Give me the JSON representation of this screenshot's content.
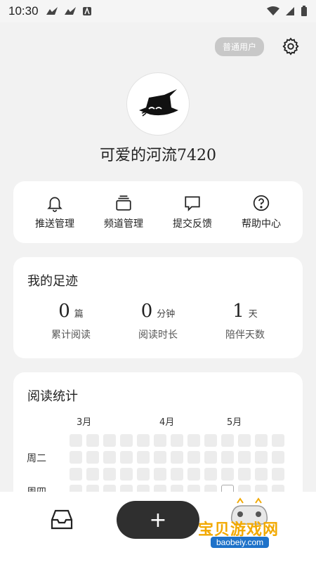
{
  "status_bar": {
    "time": "10:30"
  },
  "header": {
    "user_badge": "普通用户"
  },
  "profile": {
    "username": "可爱的河流7420"
  },
  "actions": [
    {
      "label": "推送管理",
      "icon": "bell-icon"
    },
    {
      "label": "频道管理",
      "icon": "layers-icon"
    },
    {
      "label": "提交反馈",
      "icon": "chat-bubble-icon"
    },
    {
      "label": "帮助中心",
      "icon": "question-circle-icon"
    }
  ],
  "footprint": {
    "title": "我的足迹",
    "stats": [
      {
        "value": "0",
        "unit": "篇",
        "label": "累计阅读"
      },
      {
        "value": "0",
        "unit": "分钟",
        "label": "阅读时长"
      },
      {
        "value": "1",
        "unit": "天",
        "label": "陪伴天数"
      }
    ]
  },
  "reading_stats": {
    "title": "阅读统计",
    "months": [
      "3月",
      "4月",
      "5月"
    ],
    "weekdays": [
      "周二",
      "周四"
    ]
  },
  "bottom_nav": {
    "add_label": "+"
  },
  "watermark": {
    "text": "宝贝游戏网",
    "url": "baobeiy.com"
  }
}
